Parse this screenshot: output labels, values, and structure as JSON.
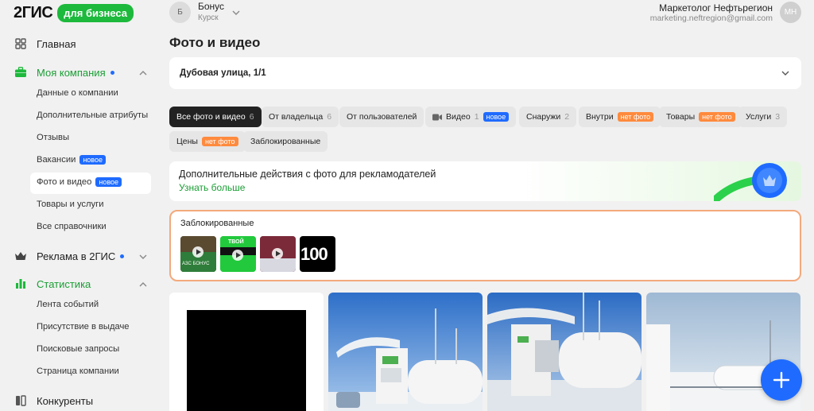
{
  "logo": {
    "brand": "2ГИС",
    "badge": "для бизнеса"
  },
  "account": {
    "avatar": "Б",
    "name": "Бонус",
    "city": "Курск"
  },
  "user": {
    "name": "Маркетолог Нефтьрегион",
    "email": "marketing.neftregion@gmail.com",
    "avatar": "МН"
  },
  "sidebar": {
    "home": "Главная",
    "company": {
      "label": "Моя компания",
      "items": [
        {
          "label": "Данные о компании"
        },
        {
          "label": "Дополнительные атрибуты"
        },
        {
          "label": "Отзывы"
        },
        {
          "label": "Вакансии",
          "badge": "новое"
        },
        {
          "label": "Фото и видео",
          "badge": "новое"
        },
        {
          "label": "Товары и услуги"
        },
        {
          "label": "Все справочники"
        }
      ]
    },
    "ads": "Реклама в 2ГИС",
    "stats": {
      "label": "Статистика",
      "items": [
        {
          "label": "Лента событий"
        },
        {
          "label": "Присутствие в выдаче"
        },
        {
          "label": "Поисковые запросы"
        },
        {
          "label": "Страница компании"
        }
      ]
    },
    "competitors": "Конкуренты"
  },
  "page": {
    "title": "Фото и видео",
    "address": "Дубовая улица, 1/1"
  },
  "filters": [
    {
      "label": "Все фото и видео",
      "count": "6"
    },
    {
      "label": "От владельца",
      "count": "6"
    },
    {
      "label": "От пользователей"
    },
    {
      "label": "Видео",
      "count": "1",
      "badge": "новое"
    },
    {
      "label": "Снаружи",
      "count": "2"
    },
    {
      "label": "Внутри",
      "badge": "нет фото"
    },
    {
      "label": "Товары",
      "badge": "нет фото"
    },
    {
      "label": "Услуги",
      "count": "3"
    },
    {
      "label": "Цены",
      "badge": "нет фото"
    },
    {
      "label": "Заблокированные"
    }
  ],
  "banner": {
    "title": "Дополнительные действия с фото для рекламодателей",
    "link": "Узнать больше"
  },
  "blocked": {
    "title": "Заблокированные",
    "thumbs": [
      {
        "caption": "АЗС БОНУС"
      },
      {
        "caption": "ТВОЙ"
      },
      {
        "caption": ""
      },
      {
        "caption": "100"
      }
    ]
  },
  "colors": {
    "accent": "#1a9e34",
    "brand_badge": "#1db93c",
    "new_badge": "#1f6bff",
    "nofoto_badge": "#ff8a3d",
    "fab": "#1f6bff"
  }
}
